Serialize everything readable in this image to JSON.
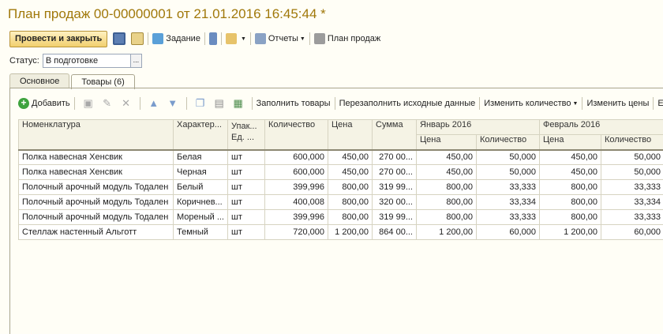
{
  "window": {
    "title": "План продаж 00-00000001 от 21.01.2016 16:45:44 *"
  },
  "toolbar": {
    "post_and_close": "Провести и закрыть",
    "task": "Задание",
    "reports": "Отчеты",
    "sales_plan": "План продаж"
  },
  "status": {
    "label": "Статус:",
    "value": "В подготовке",
    "select_btn": "..."
  },
  "tabs": [
    {
      "label": "Основное"
    },
    {
      "label": "Товары (6)"
    }
  ],
  "table_toolbar": {
    "add": "Добавить",
    "fill_goods": "Заполнить товары",
    "refill": "Перезаполнить исходные данные",
    "change_qty": "Изменить количество",
    "change_prices": "Изменить цены",
    "cut": "Е"
  },
  "columns": {
    "nomenclature": "Номенклатура",
    "characteristic": "Характер...",
    "pack": "Упак...",
    "unit": "Ед. ...",
    "quantity": "Количество",
    "price": "Цена",
    "sum": "Сумма",
    "jan": "Январь 2016",
    "feb": "Февраль 2016",
    "jan_price": "Цена",
    "jan_qty": "Количество",
    "feb_price": "Цена",
    "feb_qty": "Количество"
  },
  "rows": [
    {
      "name": "Полка навесная Хенсвик",
      "char": "Белая",
      "unit": "шт",
      "qty": "600,000",
      "price": "450,00",
      "sum": "270 00...",
      "jan_price": "450,00",
      "jan_qty": "50,000",
      "feb_price": "450,00",
      "feb_qty": "50,000"
    },
    {
      "name": "Полка навесная Хенсвик",
      "char": "Черная",
      "unit": "шт",
      "qty": "600,000",
      "price": "450,00",
      "sum": "270 00...",
      "jan_price": "450,00",
      "jan_qty": "50,000",
      "feb_price": "450,00",
      "feb_qty": "50,000"
    },
    {
      "name": "Полочный арочный модуль Тодален",
      "char": "Белый",
      "unit": "шт",
      "qty": "399,996",
      "price": "800,00",
      "sum": "319 99...",
      "jan_price": "800,00",
      "jan_qty": "33,333",
      "feb_price": "800,00",
      "feb_qty": "33,333"
    },
    {
      "name": "Полочный арочный модуль Тодален",
      "char": "Коричнев...",
      "unit": "шт",
      "qty": "400,008",
      "price": "800,00",
      "sum": "320 00...",
      "jan_price": "800,00",
      "jan_qty": "33,334",
      "feb_price": "800,00",
      "feb_qty": "33,334"
    },
    {
      "name": "Полочный арочный модуль Тодален",
      "char": "Мореный ...",
      "unit": "шт",
      "qty": "399,996",
      "price": "800,00",
      "sum": "319 99...",
      "jan_price": "800,00",
      "jan_qty": "33,333",
      "feb_price": "800,00",
      "feb_qty": "33,333"
    },
    {
      "name": "Стеллаж настенный Альготт",
      "char": "Темный",
      "unit": "шт",
      "qty": "720,000",
      "price": "1 200,00",
      "sum": "864 00...",
      "jan_price": "1 200,00",
      "jan_qty": "60,000",
      "feb_price": "1 200,00",
      "feb_qty": "60,000"
    }
  ]
}
